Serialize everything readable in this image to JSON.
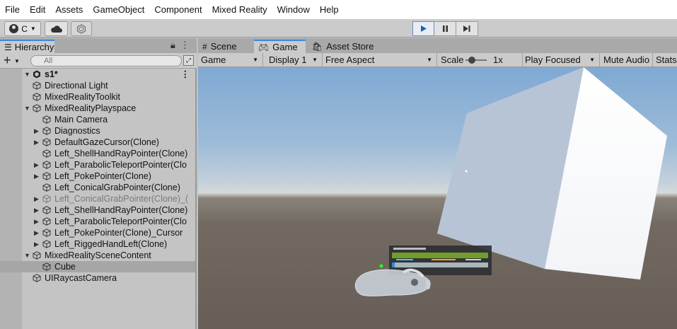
{
  "menu": [
    "File",
    "Edit",
    "Assets",
    "GameObject",
    "Component",
    "Mixed Reality",
    "Window",
    "Help"
  ],
  "toolbar": {
    "account_label": "C",
    "icons": [
      "account-icon",
      "cloud-icon",
      "collab-icon",
      "play-icon",
      "pause-icon",
      "step-icon"
    ]
  },
  "hierarchy": {
    "tab_title": "Hierarchy",
    "search_placeholder": "All",
    "scene_name": "s1*",
    "items": [
      {
        "label": "Directional Light",
        "depth": 1,
        "arrow": false
      },
      {
        "label": "MixedRealityToolkit",
        "depth": 1,
        "arrow": false
      },
      {
        "label": "MixedRealityPlayspace",
        "depth": 1,
        "arrow": "down"
      },
      {
        "label": "Main Camera",
        "depth": 2,
        "arrow": false
      },
      {
        "label": "Diagnostics",
        "depth": 2,
        "arrow": "right"
      },
      {
        "label": "DefaultGazeCursor(Clone)",
        "depth": 2,
        "arrow": "right"
      },
      {
        "label": "Left_ShellHandRayPointer(Clone)",
        "depth": 2,
        "arrow": false
      },
      {
        "label": "Left_ParabolicTeleportPointer(Clo",
        "depth": 2,
        "arrow": "right"
      },
      {
        "label": "Left_PokePointer(Clone)",
        "depth": 2,
        "arrow": "right"
      },
      {
        "label": "Left_ConicalGrabPointer(Clone)",
        "depth": 2,
        "arrow": false
      },
      {
        "label": "Left_ConicalGrabPointer(Clone)_(",
        "depth": 2,
        "arrow": "right",
        "disabled": true
      },
      {
        "label": "Left_ShellHandRayPointer(Clone)",
        "depth": 2,
        "arrow": "right"
      },
      {
        "label": "Left_ParabolicTeleportPointer(Clo",
        "depth": 2,
        "arrow": "right"
      },
      {
        "label": "Left_PokePointer(Clone)_Cursor",
        "depth": 2,
        "arrow": "right"
      },
      {
        "label": "Left_RiggedHandLeft(Clone)",
        "depth": 2,
        "arrow": "right"
      },
      {
        "label": "MixedRealitySceneContent",
        "depth": 1,
        "arrow": "down"
      },
      {
        "label": "Cube",
        "depth": 2,
        "arrow": false,
        "selected": true
      },
      {
        "label": "UIRaycastCamera",
        "depth": 1,
        "arrow": false
      }
    ]
  },
  "game_view": {
    "tabs": [
      "Scene",
      "Game",
      "Asset Store"
    ],
    "display_mode": "Game",
    "display": "Display 1",
    "aspect": "Free Aspect",
    "scale_label": "Scale",
    "scale_value": "1x",
    "play_mode": "Play Focused",
    "mute_audio": "Mute Audio",
    "stats": "Stats"
  }
}
